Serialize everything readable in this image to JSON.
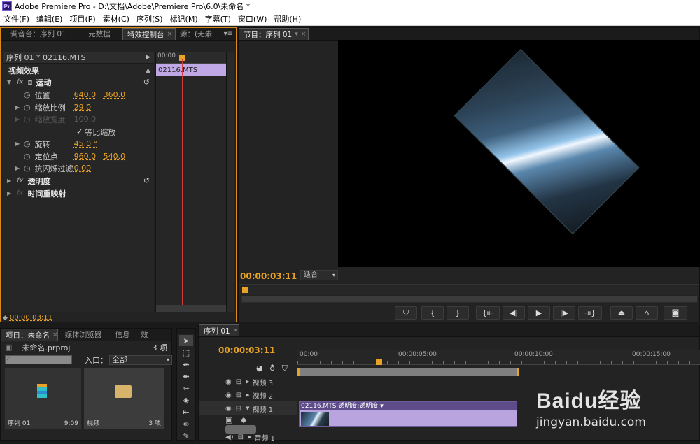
{
  "window": {
    "title": "Adobe Premiere Pro - D:\\文档\\Adobe\\Premiere Pro\\6.0\\未命名 *",
    "icon": "Pr"
  },
  "menu": [
    "文件(F)",
    "编辑(E)",
    "项目(P)",
    "素材(C)",
    "序列(S)",
    "标记(M)",
    "字幕(T)",
    "窗口(W)",
    "帮助(H)"
  ],
  "effects_panel": {
    "tabs": [
      "调音台：序列 01",
      "元数据",
      "特效控制台",
      "源：(无素"
    ],
    "sequence_label": "序列 01 * 02116.MTS",
    "ruler_time": "00:00",
    "clip_name": "02116.MTS",
    "video_effects_label": "视频效果",
    "motion_label": "运动",
    "position_label": "位置",
    "position_x": "640.0",
    "position_y": "360.0",
    "scale_label": "缩放比例",
    "scale_value": "29.0",
    "scale_width_label": "缩放宽度",
    "scale_width_value": "100.0",
    "uniform_scale_label": "等比缩放",
    "rotation_label": "旋转",
    "rotation_value": "45.0 °",
    "anchor_label": "定位点",
    "anchor_x": "960.0",
    "anchor_y": "540.0",
    "flicker_label": "抗闪烁过滤",
    "flicker_value": "0.00",
    "opacity_label": "透明度",
    "time_remap_label": "时间重映射",
    "timecode": "00:00:03:11"
  },
  "program_monitor": {
    "tab": "节目：序列 01",
    "timecode": "00:00:03:11",
    "fit_label": "适合",
    "controls": [
      "marker",
      "in-point",
      "out-point",
      "go-to-in",
      "step-back",
      "play",
      "step-forward",
      "go-to-out",
      "lift",
      "extract",
      "export-frame"
    ]
  },
  "project_panel": {
    "tabs": [
      "项目：未命名",
      "媒体浏览器",
      "信息",
      "效"
    ],
    "project_name": "未命名.prproj",
    "item_count": "3 项",
    "in_label": "入口：",
    "in_value": "全部",
    "item1_name": "序列 01",
    "item1_duration": "9:09",
    "item2_name": "视频",
    "item2_count": "3 项"
  },
  "timeline": {
    "tab": "序列 01",
    "timecode": "00:00:03:11",
    "ruler_labels": [
      "00:00",
      "00:00:05:00",
      "00:00:10:00",
      "00:00:15:00"
    ],
    "tracks": [
      {
        "name": "视频 3"
      },
      {
        "name": "视频 2"
      },
      {
        "name": "视频 1"
      },
      {
        "name": "音频 1"
      }
    ],
    "clip_label": "02116.MTS  透明度:透明度 ▾"
  },
  "watermark": {
    "text": "Baidu经验",
    "url_text": "jingyan.baidu.com"
  },
  "colors": {
    "accent": "#e8a227",
    "clip": "#b9a4df",
    "playhead": "#d23b3b"
  }
}
